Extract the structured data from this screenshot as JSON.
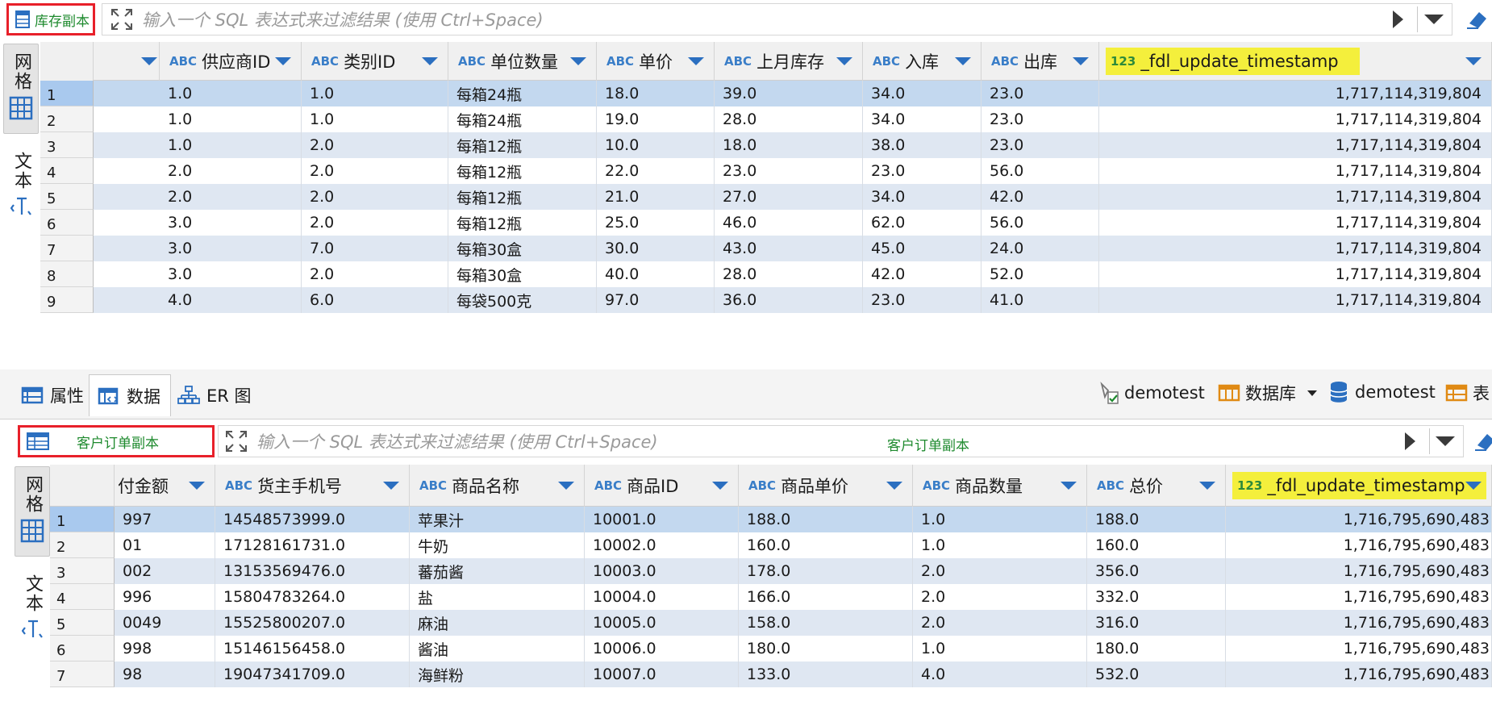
{
  "filter_placeholder": "输入一个 SQL 表达式来过滤结果 (使用 Ctrl+Space)",
  "view_tabs": {
    "grid": "网格",
    "text": "文本"
  },
  "top": {
    "table_name": "库存副本",
    "columns": [
      {
        "type": "ABC",
        "name": "供应商ID"
      },
      {
        "type": "ABC",
        "name": "类别ID"
      },
      {
        "type": "ABC",
        "name": "单位数量"
      },
      {
        "type": "ABC",
        "name": "单价"
      },
      {
        "type": "ABC",
        "name": "上月库存"
      },
      {
        "type": "ABC",
        "name": "入库"
      },
      {
        "type": "ABC",
        "name": "出库"
      },
      {
        "type": "123",
        "name": "_fdl_update_timestamp"
      }
    ],
    "rows": [
      {
        "n": "1",
        "c": [
          "1.0",
          "1.0",
          "每箱24瓶",
          "18.0",
          "39.0",
          "34.0",
          "23.0",
          "1,717,114,319,804"
        ]
      },
      {
        "n": "2",
        "c": [
          "1.0",
          "1.0",
          "每箱24瓶",
          "19.0",
          "28.0",
          "34.0",
          "23.0",
          "1,717,114,319,804"
        ]
      },
      {
        "n": "3",
        "c": [
          "1.0",
          "2.0",
          "每箱12瓶",
          "10.0",
          "18.0",
          "38.0",
          "23.0",
          "1,717,114,319,804"
        ]
      },
      {
        "n": "4",
        "c": [
          "2.0",
          "2.0",
          "每箱12瓶",
          "22.0",
          "23.0",
          "23.0",
          "56.0",
          "1,717,114,319,804"
        ]
      },
      {
        "n": "5",
        "c": [
          "2.0",
          "2.0",
          "每箱12瓶",
          "21.0",
          "27.0",
          "34.0",
          "42.0",
          "1,717,114,319,804"
        ]
      },
      {
        "n": "6",
        "c": [
          "3.0",
          "2.0",
          "每箱12瓶",
          "25.0",
          "46.0",
          "62.0",
          "56.0",
          "1,717,114,319,804"
        ]
      },
      {
        "n": "7",
        "c": [
          "3.0",
          "7.0",
          "每箱30盒",
          "30.0",
          "43.0",
          "45.0",
          "24.0",
          "1,717,114,319,804"
        ]
      },
      {
        "n": "8",
        "c": [
          "3.0",
          "2.0",
          "每箱30盒",
          "40.0",
          "28.0",
          "42.0",
          "52.0",
          "1,717,114,319,804"
        ]
      },
      {
        "n": "9",
        "c": [
          "4.0",
          "6.0",
          "每袋500克",
          "97.0",
          "36.0",
          "23.0",
          "41.0",
          "1,717,114,319,804"
        ]
      }
    ]
  },
  "editor_tabs": [
    {
      "label": "属性",
      "icon": "properties-icon"
    },
    {
      "label": "数据",
      "icon": "data-icon"
    },
    {
      "label": "ER 图",
      "icon": "er-diagram-icon"
    }
  ],
  "toolbar_right": {
    "connection": "demotest",
    "database_label": "数据库",
    "schema": "demotest",
    "table_label": "表"
  },
  "bottom": {
    "table_name": "客户订单副本",
    "center_label": "客户订单副本",
    "columns": [
      {
        "type": "",
        "name": "付金额"
      },
      {
        "type": "ABC",
        "name": "货主手机号"
      },
      {
        "type": "ABC",
        "name": "商品名称"
      },
      {
        "type": "ABC",
        "name": "商品ID"
      },
      {
        "type": "ABC",
        "name": "商品单价"
      },
      {
        "type": "ABC",
        "name": "商品数量"
      },
      {
        "type": "ABC",
        "name": "总价"
      },
      {
        "type": "123",
        "name": "_fdl_update_timestamp"
      }
    ],
    "rows": [
      {
        "n": "1",
        "c": [
          "997",
          "14548573999.0",
          "苹果汁",
          "10001.0",
          "188.0",
          "1.0",
          "188.0",
          "1,716,795,690,483"
        ]
      },
      {
        "n": "2",
        "c": [
          "01",
          "17128161731.0",
          "牛奶",
          "10002.0",
          "160.0",
          "1.0",
          "160.0",
          "1,716,795,690,483"
        ]
      },
      {
        "n": "3",
        "c": [
          "002",
          "13153569476.0",
          "蕃茄酱",
          "10003.0",
          "178.0",
          "2.0",
          "356.0",
          "1,716,795,690,483"
        ]
      },
      {
        "n": "4",
        "c": [
          "996",
          "15804783264.0",
          "盐",
          "10004.0",
          "166.0",
          "2.0",
          "332.0",
          "1,716,795,690,483"
        ]
      },
      {
        "n": "5",
        "c": [
          "0049",
          "15525800207.0",
          "麻油",
          "10005.0",
          "158.0",
          "2.0",
          "316.0",
          "1,716,795,690,483"
        ]
      },
      {
        "n": "6",
        "c": [
          "998",
          "15146156458.0",
          "酱油",
          "10006.0",
          "180.0",
          "1.0",
          "180.0",
          "1,716,795,690,483"
        ]
      },
      {
        "n": "7",
        "c": [
          "98",
          "19047341709.0",
          "海鲜粉",
          "10007.0",
          "133.0",
          "4.0",
          "532.0",
          "1,716,795,690,483"
        ]
      }
    ]
  },
  "colors": {
    "accent_blue": "#2b6fc0",
    "highlight_yellow": "#f4ef3c",
    "red_box": "#e8202a",
    "green_text": "#1e8a2e",
    "row_alt": "#dfe7f2",
    "row_selected": "#c3d8ef"
  }
}
